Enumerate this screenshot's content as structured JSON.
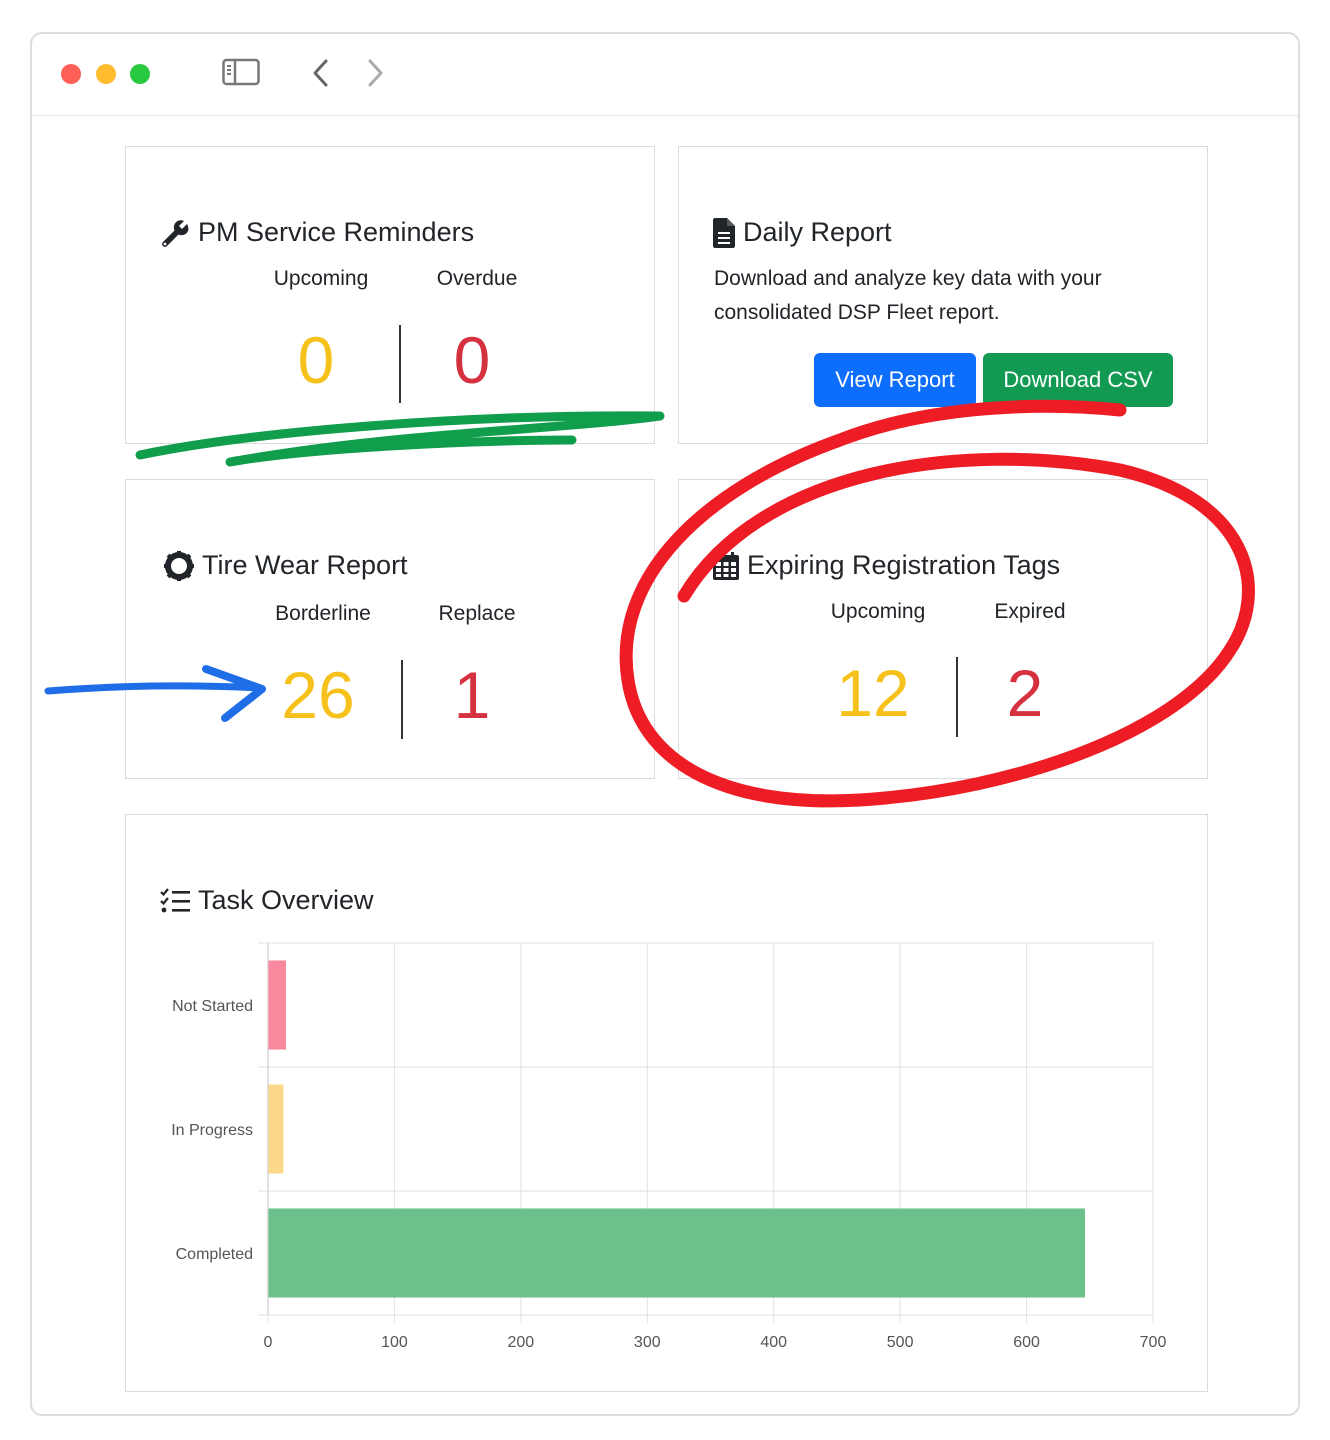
{
  "colors": {
    "warning": "#f6c11a",
    "danger": "#d5313e",
    "primary": "#0d6efd",
    "success": "#139a52",
    "bar_not_started": "#f7889d",
    "bar_in_progress": "#fbd88a",
    "bar_completed": "#6cc18a"
  },
  "pm": {
    "icon": "wrench-icon",
    "title": "PM Service Reminders",
    "upcoming_label": "Upcoming",
    "overdue_label": "Overdue",
    "upcoming_value": "0",
    "overdue_value": "0"
  },
  "daily": {
    "icon": "file-icon",
    "title": "Daily Report",
    "desc_line1": "Download and analyze key data with your",
    "desc_line2": "consolidated DSP Fleet report.",
    "view_label": "View Report",
    "download_label": "Download CSV"
  },
  "tire": {
    "icon": "tire-icon",
    "title": "Tire Wear Report",
    "borderline_label": "Borderline",
    "replace_label": "Replace",
    "borderline_value": "26",
    "replace_value": "1"
  },
  "tags": {
    "icon": "calendar-icon",
    "title": "Expiring Registration Tags",
    "upcoming_label": "Upcoming",
    "expired_label": "Expired",
    "upcoming_value": "12",
    "expired_value": "2"
  },
  "tasks": {
    "icon": "tasks-icon",
    "title": "Task Overview"
  },
  "chart_data": {
    "type": "bar",
    "orientation": "horizontal",
    "categories": [
      "Not Started",
      "In Progress",
      "Completed"
    ],
    "values": [
      13,
      11,
      645
    ],
    "xlim": [
      0,
      700
    ],
    "xticks": [
      "0",
      "100",
      "200",
      "300",
      "400",
      "500",
      "600",
      "700"
    ],
    "grid": true
  }
}
